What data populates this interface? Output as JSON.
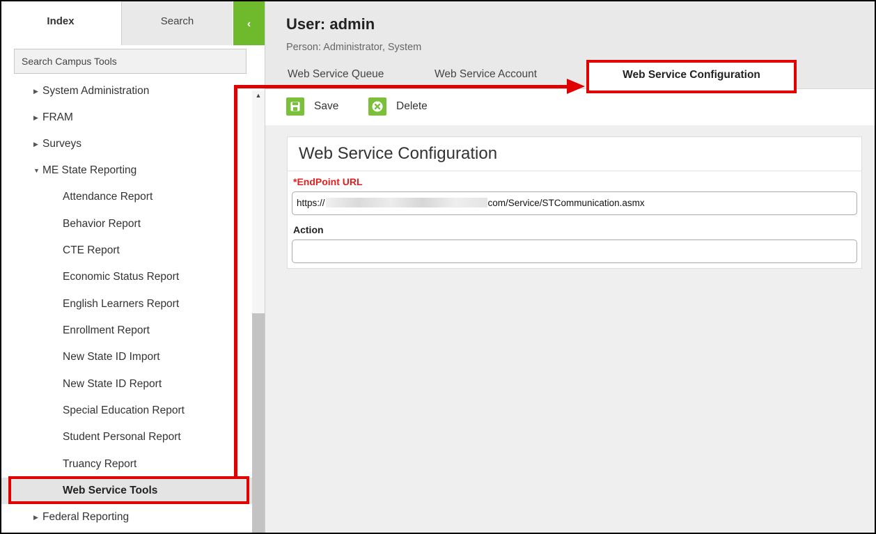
{
  "left_panel": {
    "tabs": {
      "index": "Index",
      "search": "Search"
    },
    "collapse_glyph": "‹",
    "search_placeholder": "Search Campus Tools",
    "tree": [
      {
        "label": "System Administration",
        "level": 1,
        "expandable": true,
        "expanded": false
      },
      {
        "label": "FRAM",
        "level": 1,
        "expandable": true,
        "expanded": false
      },
      {
        "label": "Surveys",
        "level": 1,
        "expandable": true,
        "expanded": false
      },
      {
        "label": "ME State Reporting",
        "level": 1,
        "expandable": true,
        "expanded": true
      },
      {
        "label": "Attendance Report",
        "level": 2
      },
      {
        "label": "Behavior Report",
        "level": 2
      },
      {
        "label": "CTE Report",
        "level": 2
      },
      {
        "label": "Economic Status Report",
        "level": 2
      },
      {
        "label": "English Learners Report",
        "level": 2
      },
      {
        "label": "Enrollment Report",
        "level": 2
      },
      {
        "label": "New State ID Import",
        "level": 2
      },
      {
        "label": "New State ID Report",
        "level": 2
      },
      {
        "label": "Special Education Report",
        "level": 2
      },
      {
        "label": "Student Personal Report",
        "level": 2
      },
      {
        "label": "Truancy Report",
        "level": 2
      },
      {
        "label": "Web Service Tools",
        "level": 2,
        "selected": true
      },
      {
        "label": "Federal Reporting",
        "level": 1,
        "expandable": true,
        "expanded": false
      }
    ]
  },
  "header": {
    "title": "User: admin",
    "person": "Person: Administrator, System"
  },
  "subtabs": [
    "Web Service Queue",
    "Web Service Account",
    "Web Service Configuration"
  ],
  "active_subtab": "Web Service Configuration",
  "toolbar": {
    "save_label": "Save",
    "delete_label": "Delete"
  },
  "card": {
    "title": "Web Service Configuration",
    "endpoint_label_req": "*",
    "endpoint_label": "EndPoint URL",
    "endpoint_value_prefix": "https://",
    "endpoint_value_suffix": "com/Service/STCommunication.asmx",
    "action_label": "Action",
    "action_value": ""
  },
  "colors": {
    "accent_green": "#6fba2c",
    "annotation_red": "#e00000",
    "required_red": "#e02020"
  },
  "icons": [
    "chevron-left-icon",
    "save-icon",
    "delete-icon",
    "triangle-right-icon",
    "triangle-down-icon",
    "scroll-up-icon"
  ]
}
